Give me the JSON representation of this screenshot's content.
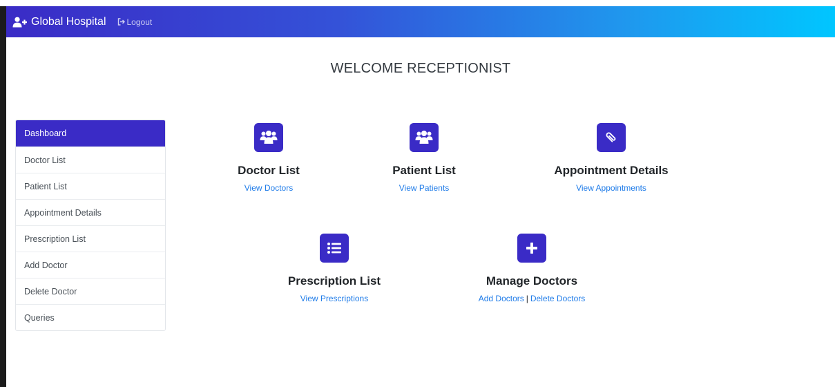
{
  "navbar": {
    "brand": "Global Hospital",
    "brand_icon": "user-plus-icon",
    "logout_label": "Logout",
    "logout_icon": "sign-out-icon",
    "gradient": [
      "#3a2bc6",
      "#00c6ff"
    ]
  },
  "welcome": "WELCOME RECEPTIONIST",
  "sidebar": {
    "items": [
      {
        "label": "Dashboard",
        "active": true
      },
      {
        "label": "Doctor List"
      },
      {
        "label": "Patient List"
      },
      {
        "label": "Appointment Details"
      },
      {
        "label": "Prescription List"
      },
      {
        "label": "Add Doctor"
      },
      {
        "label": "Delete Doctor"
      },
      {
        "label": "Queries"
      }
    ],
    "active_color": "#3a2bc6"
  },
  "cards": {
    "doctor_list": {
      "title": "Doctor List",
      "link": "View Doctors",
      "icon": "users-icon"
    },
    "patient_list": {
      "title": "Patient List",
      "link": "View Patients",
      "icon": "users-icon"
    },
    "appointment_details": {
      "title": "Appointment Details",
      "link": "View Appointments",
      "icon": "paperclip-icon"
    },
    "prescription_list": {
      "title": "Prescription List",
      "link": "View Prescriptions",
      "icon": "list-icon"
    },
    "manage_doctors": {
      "title": "Manage Doctors",
      "link_add": "Add Doctors",
      "separator": "|",
      "link_delete": "Delete Doctors",
      "icon": "plus-icon"
    }
  },
  "colors": {
    "accent": "#3a2bc6",
    "link": "#1e7be8"
  }
}
